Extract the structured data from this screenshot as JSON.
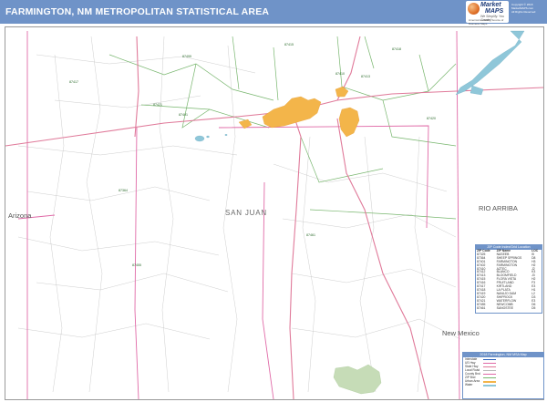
{
  "header": {
    "title": "FARMINGTON, NM METROPOLITAN STATISTICAL AREA",
    "brand_line1": "Market",
    "brand_line2": "MAPS",
    "brand_tagline": "We Simplify. You Create!",
    "brand_sub": "America's Leading Source of Business Maps",
    "copyright_lines": [
      "Copyright © 2018",
      "MarketMAPS.com",
      "All Rights Reserved"
    ],
    "colors": {
      "title_bar": "#6f93c8",
      "brand": "#1c3a78"
    }
  },
  "map": {
    "county_label": "SAN JUAN",
    "neighbors": {
      "west": "Arizona",
      "east": "RIO ARRIBA",
      "southeast": "New Mexico"
    },
    "colors": {
      "land": "#ffffff",
      "urban": "#f3b54a",
      "water": "#8fc7d9",
      "forest": "#c6dcb7",
      "zip_boundary": "#78b66e",
      "county_line": "#e06aa7",
      "highway": "#e07a9a"
    },
    "road_labels": [
      "87415",
      "87420",
      "87413",
      "87421",
      "87401",
      "87499",
      "87410",
      "87417",
      "87418",
      "87364",
      "87461",
      "87455"
    ]
  },
  "zip_legend": {
    "title": "ZIP Code Index/Grid Location",
    "columns": [
      "ZIP Code",
      "ZIP Name",
      "LOC"
    ],
    "rows": [
      [
        "87325",
        "NASEEB",
        "I5"
      ],
      [
        "87364",
        "SHEEP SPRINGS",
        "D8"
      ],
      [
        "87401",
        "FARMINGTON",
        "H3"
      ],
      [
        "87402",
        "FARMINGTON",
        "H2"
      ],
      [
        "87410",
        "AZTEC",
        "J2"
      ],
      [
        "87412",
        "BLANCO",
        "K3"
      ],
      [
        "87413",
        "BLOOMFIELD",
        "J3"
      ],
      [
        "87415",
        "FLORA VISTA",
        "H2"
      ],
      [
        "87416",
        "FRUITLAND",
        "F3"
      ],
      [
        "87417",
        "KIRTLAND",
        "E3"
      ],
      [
        "87418",
        "LA PLATA",
        "H1"
      ],
      [
        "87419",
        "NAVAJO DAM",
        "L2"
      ],
      [
        "87420",
        "SHIPROCK",
        "D3"
      ],
      [
        "87421",
        "WATERFLOW",
        "E3"
      ],
      [
        "87455",
        "NEWCOMB",
        "D6"
      ],
      [
        "87461",
        "SANOSTEE",
        "D5"
      ]
    ]
  },
  "map_legend": {
    "title": "2018 Farmington, NM MSA Map",
    "items": [
      {
        "label": "Interstate",
        "color": "#2b5fb8"
      },
      {
        "label": "US Hwy",
        "color": "#e06aa7"
      },
      {
        "label": "State Hwy",
        "color": "#e07a9a"
      },
      {
        "label": "Local Road",
        "color": "#b9b9b9"
      },
      {
        "label": "County Bnd",
        "color": "#e06aa7"
      },
      {
        "label": "ZIP Bnd",
        "color": "#78b66e"
      },
      {
        "label": "Urban Area",
        "color": "#f3b54a"
      },
      {
        "label": "Water",
        "color": "#8fc7d9"
      }
    ]
  }
}
